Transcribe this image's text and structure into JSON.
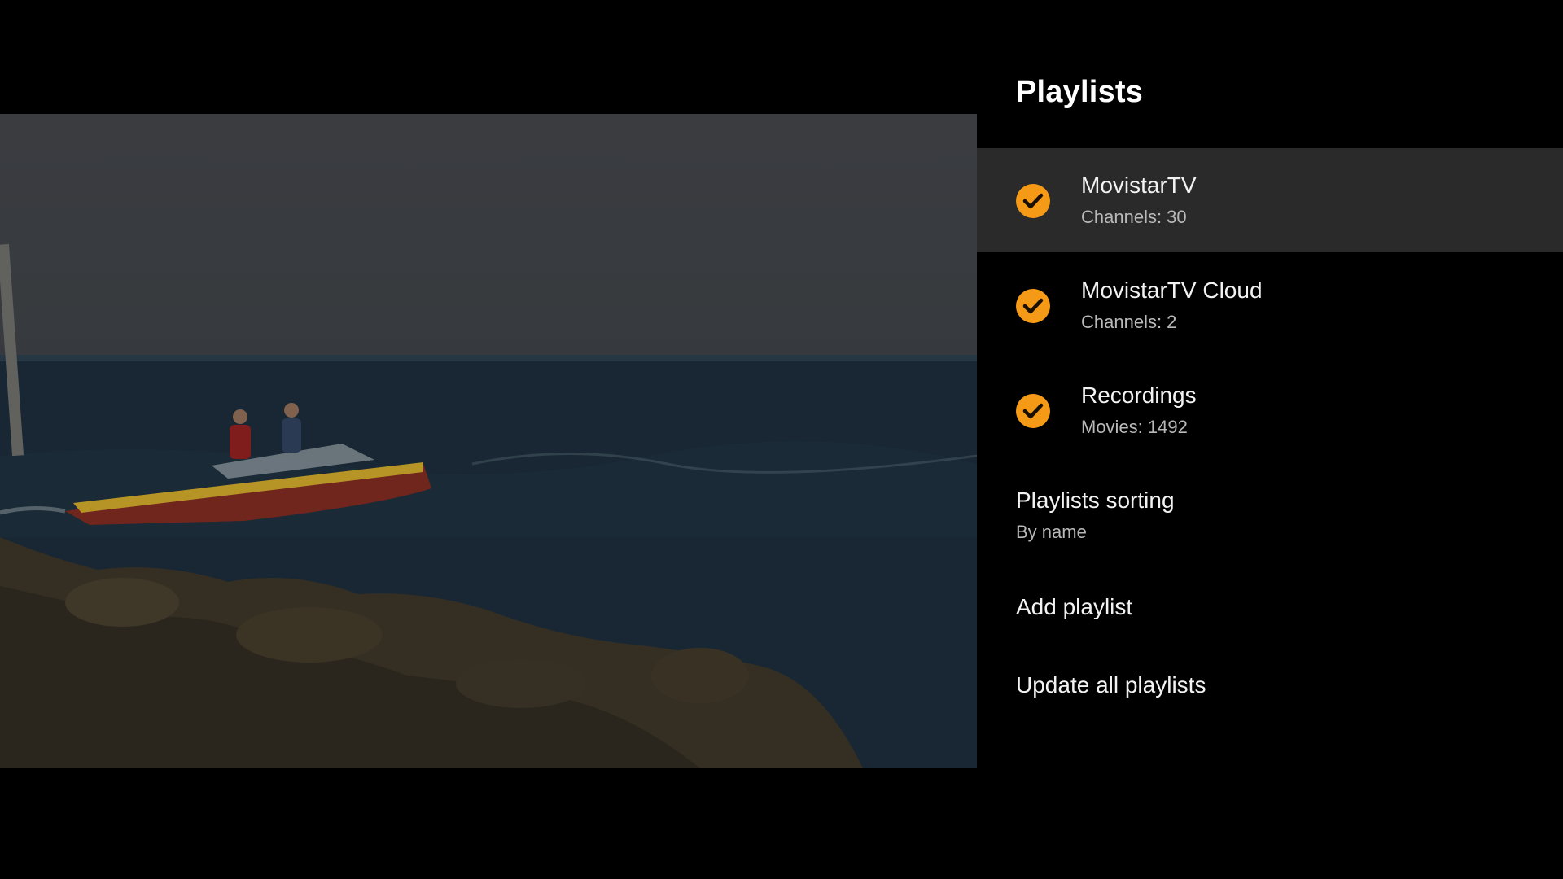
{
  "panel": {
    "title": "Playlists",
    "playlists": [
      {
        "name": "MovistarTV",
        "detail": "Channels: 30",
        "checked": true,
        "focused": true,
        "icon": "check-circle-icon"
      },
      {
        "name": "MovistarTV Cloud",
        "detail": "Channels: 2",
        "checked": true,
        "focused": false,
        "icon": "check-circle-icon"
      },
      {
        "name": "Recordings",
        "detail": "Movies: 1492",
        "checked": true,
        "focused": false,
        "icon": "check-circle-icon"
      }
    ],
    "sorting": {
      "label": "Playlists sorting",
      "value": "By name"
    },
    "add_label": "Add playlist",
    "update_label": "Update all playlists"
  },
  "colors": {
    "accent": "#f59a16",
    "focus_row": "#2a2a2a",
    "background": "#000000"
  }
}
